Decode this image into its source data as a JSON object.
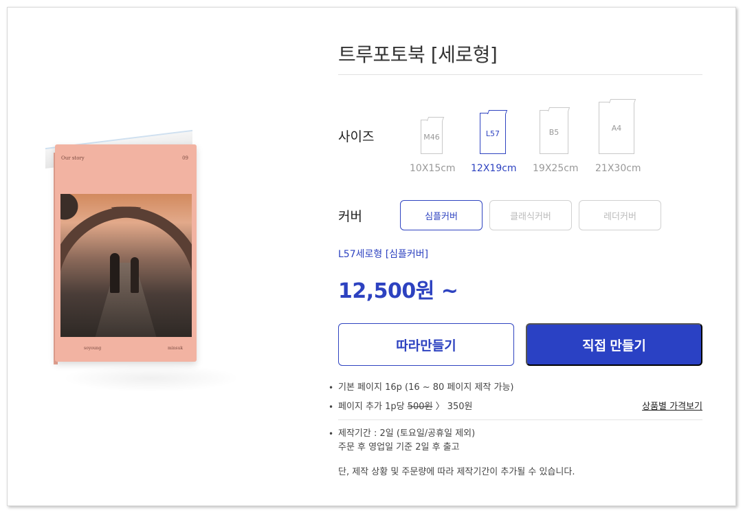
{
  "product": {
    "title": "트루포토북 [세로형]",
    "book_cover": {
      "header_left": "Our story",
      "header_right": "09",
      "footer_left": "soyoung",
      "footer_right": "minsuk"
    }
  },
  "size": {
    "label": "사이즈",
    "options": [
      {
        "code": "M46",
        "caption": "10X15cm",
        "selected": false
      },
      {
        "code": "L57",
        "caption": "12X19cm",
        "selected": true
      },
      {
        "code": "B5",
        "caption": "19X25cm",
        "selected": false
      },
      {
        "code": "A4",
        "caption": "21X30cm",
        "selected": false
      }
    ]
  },
  "cover": {
    "label": "커버",
    "options": [
      {
        "label": "심플커버",
        "selected": true
      },
      {
        "label": "클래식커버",
        "selected": false
      },
      {
        "label": "레더커버",
        "selected": false
      }
    ]
  },
  "selection_summary": "L57세로형 [심플커버]",
  "price": "12,500원 ~",
  "buttons": {
    "follow": "따라만들기",
    "make": "직접 만들기"
  },
  "info": {
    "base_pages": "기본 페이지 16p (16 ~ 80 페이지 제작 가능)",
    "extra_page_prefix": "페이지 추가 1p당 ",
    "extra_page_old": "500원",
    "extra_page_new": " 〉 350원",
    "price_link": "상품별 가격보기",
    "period_line1": "제작기간 : 2일 (토요일/공휴일 제외)",
    "period_line2": "주문 후 영업일 기준 2일 후 출고",
    "period_note": "단, 제작 상황 및 주문량에 따라 제작기간이 추가될 수 있습니다."
  },
  "colors": {
    "accent": "#2d42c0",
    "primary_button": "#2a41c4",
    "book_cover": "#f2b3a2"
  }
}
